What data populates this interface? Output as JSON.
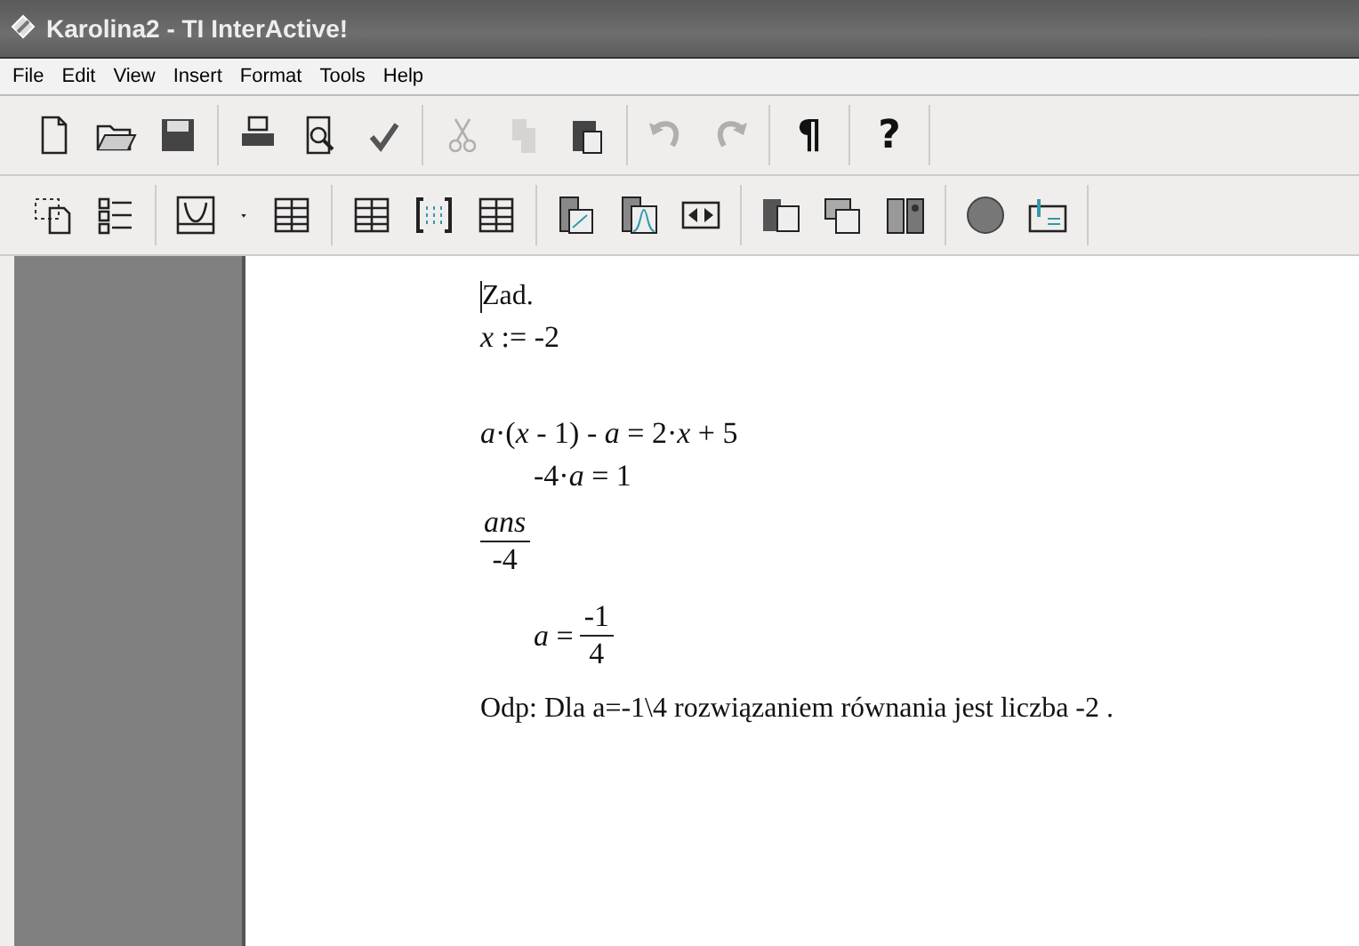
{
  "window": {
    "title": "Karolina2 - TI InterActive!"
  },
  "menu": [
    "File",
    "Edit",
    "View",
    "Insert",
    "Format",
    "Tools",
    "Help"
  ],
  "toolbars": [
    {
      "groups": [
        [
          {
            "disabled": false
          },
          {
            "disabled": false
          },
          {
            "disabled": false
          }
        ],
        [
          {
            "disabled": false
          },
          {
            "disabled": false
          },
          {
            "disabled": false
          }
        ],
        [
          {
            "disabled": true
          },
          {
            "disabled": true
          },
          {
            "disabled": false
          }
        ],
        [
          {
            "disabled": true
          },
          {
            "disabled": true
          }
        ],
        [
          {
            "disabled": false,
            "glyph": "¶"
          }
        ],
        [
          {
            "disabled": false,
            "glyph": "?"
          }
        ]
      ]
    },
    {
      "groups": [
        [
          {
            "disabled": false
          },
          {
            "disabled": false
          }
        ],
        [
          {
            "disabled": false
          },
          {
            "disabled": false
          },
          {
            "disabled": false
          }
        ],
        [
          {
            "disabled": false
          },
          {
            "disabled": false
          },
          {
            "disabled": false
          }
        ],
        [
          {
            "disabled": false
          },
          {
            "disabled": false
          },
          {
            "disabled": false
          }
        ],
        [
          {
            "disabled": false
          },
          {
            "disabled": false
          },
          {
            "disabled": false
          }
        ],
        [
          {
            "disabled": false
          },
          {
            "disabled": false
          }
        ]
      ]
    }
  ],
  "document": [
    {
      "kind": "text",
      "text": "Zad.",
      "cursor": true
    },
    {
      "kind": "math",
      "text": "*x* := -2"
    },
    {
      "kind": "math",
      "text": "*a*·(*x* - 1) - *a* = 2·*x* + 5",
      "spaced": true
    },
    {
      "kind": "math",
      "text": "-4·*a* = 1",
      "indented": true
    },
    {
      "kind": "fraction",
      "numerator": "*ans*",
      "denominator": "-4"
    },
    {
      "kind": "fraction",
      "prefix": "*a* =",
      "numerator": "-1",
      "denominator": "4",
      "indented": true
    },
    {
      "kind": "text",
      "text": "Odp: Dla a=-1\\4 rozwiązaniem równania jest liczba -2 ."
    }
  ]
}
